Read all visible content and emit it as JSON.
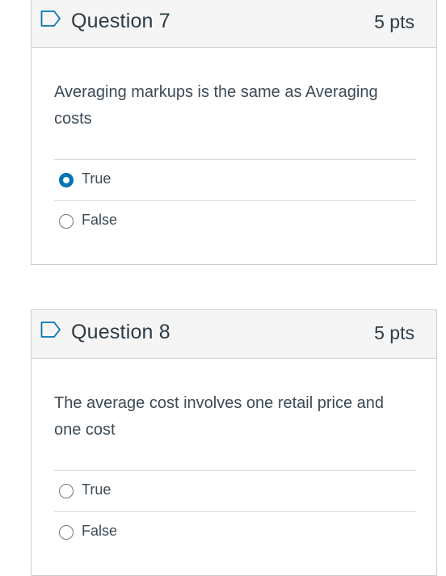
{
  "questions": [
    {
      "title": "Question 7",
      "points": "5 pts",
      "text": "Averaging markups is the same as Averaging costs",
      "answers": [
        {
          "label": "True",
          "selected": true
        },
        {
          "label": "False",
          "selected": false
        }
      ]
    },
    {
      "title": "Question 8",
      "points": "5 pts",
      "text": "The average cost involves one retail price and one cost",
      "answers": [
        {
          "label": "True",
          "selected": false
        },
        {
          "label": "False",
          "selected": false
        }
      ]
    }
  ],
  "colors": {
    "accent": "#0374b5",
    "border": "#c7cdd1",
    "header_bg": "#f5f5f5",
    "text": "#2d3b45"
  }
}
